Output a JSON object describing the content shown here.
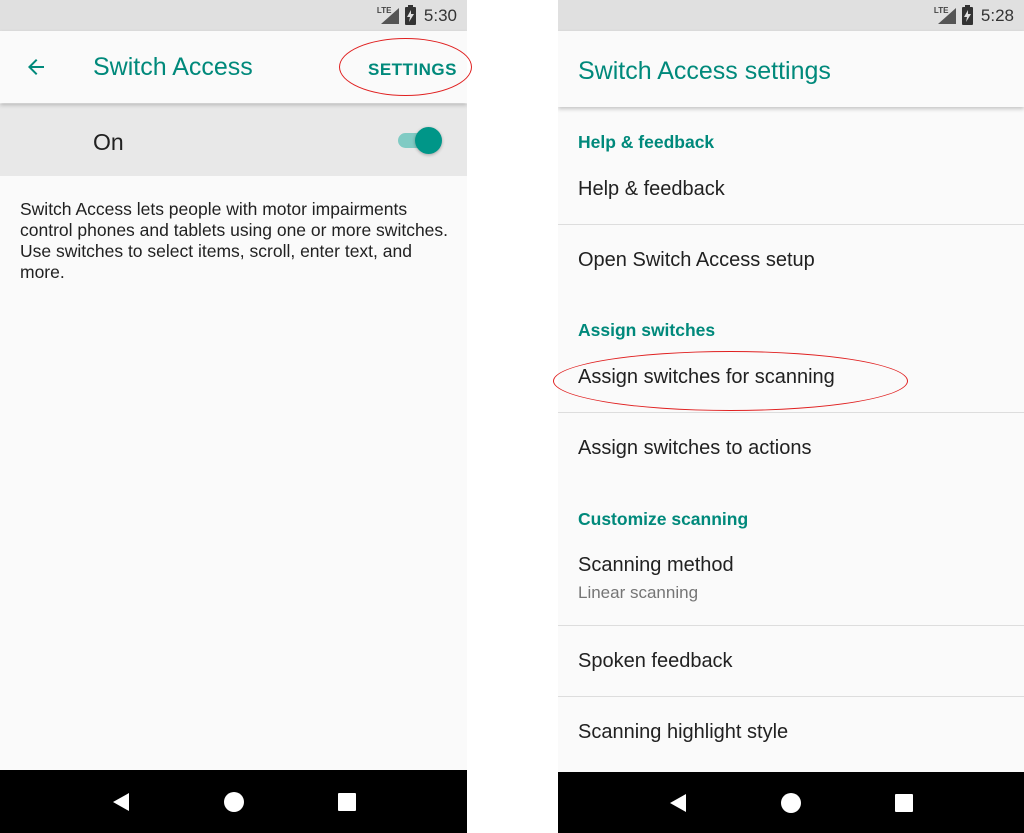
{
  "left": {
    "status": {
      "network": "LTE",
      "time": "5:30"
    },
    "appbar": {
      "title": "Switch Access",
      "settings_label": "SETTINGS"
    },
    "toggle": {
      "label": "On",
      "checked": true
    },
    "description": "Switch Access lets people with motor impairments control phones and tablets using one or more switches. Use switches to select items, scroll, enter text, and more."
  },
  "right": {
    "status": {
      "network": "LTE",
      "time": "5:28"
    },
    "appbar": {
      "title": "Switch Access settings"
    },
    "sections": [
      {
        "header": "Help & feedback",
        "items": [
          {
            "title": "Help & feedback"
          },
          {
            "title": "Open Switch Access setup"
          }
        ]
      },
      {
        "header": "Assign switches",
        "items": [
          {
            "title": "Assign switches for scanning"
          },
          {
            "title": "Assign switches to actions"
          }
        ]
      },
      {
        "header": "Customize scanning",
        "items": [
          {
            "title": "Scanning method",
            "summary": "Linear scanning"
          },
          {
            "title": "Spoken feedback"
          },
          {
            "title": "Scanning highlight style"
          }
        ]
      }
    ]
  },
  "colors": {
    "accent": "#00897b",
    "annotation": "#e02020"
  }
}
